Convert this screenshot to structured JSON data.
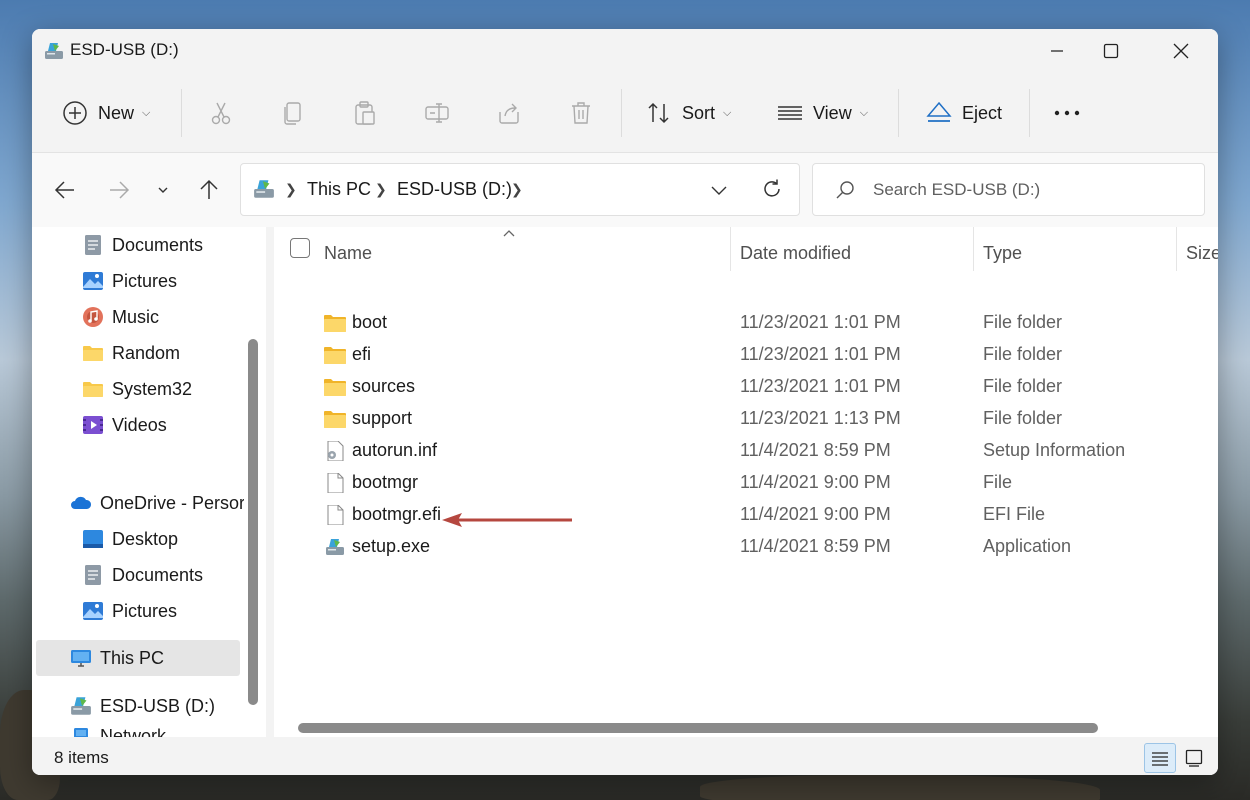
{
  "window": {
    "title": "ESD-USB (D:)",
    "controls": {
      "minimize": "minimize",
      "maximize": "maximize",
      "close": "close"
    }
  },
  "toolbar": {
    "new_label": "New",
    "sort_label": "Sort",
    "view_label": "View",
    "eject_label": "Eject"
  },
  "address": {
    "crumbs": [
      "This PC",
      "ESD-USB (D:)"
    ]
  },
  "search": {
    "placeholder": "Search ESD-USB (D:)"
  },
  "sidebar": {
    "items": [
      {
        "label": "Documents",
        "icon": "documents-icon",
        "pinned": true
      },
      {
        "label": "Pictures",
        "icon": "pictures-icon",
        "pinned": true
      },
      {
        "label": "Music",
        "icon": "music-icon"
      },
      {
        "label": "Random",
        "icon": "folder-icon"
      },
      {
        "label": "System32",
        "icon": "folder-icon"
      },
      {
        "label": "Videos",
        "icon": "videos-icon"
      },
      {
        "label": "OneDrive - Persor",
        "icon": "onedrive-icon"
      },
      {
        "label": "Desktop",
        "icon": "desktop-icon"
      },
      {
        "label": "Documents",
        "icon": "documents-icon"
      },
      {
        "label": "Pictures",
        "icon": "pictures-icon"
      },
      {
        "label": "This PC",
        "icon": "this-pc-icon",
        "selected": true
      },
      {
        "label": "ESD-USB (D:)",
        "icon": "usb-drive-icon"
      },
      {
        "label": "Network",
        "icon": "network-icon"
      }
    ]
  },
  "columns": {
    "name": "Name",
    "date": "Date modified",
    "type": "Type",
    "size": "Size"
  },
  "files": [
    {
      "name": "boot",
      "date": "11/23/2021 1:01 PM",
      "type": "File folder",
      "icon": "folder-icon"
    },
    {
      "name": "efi",
      "date": "11/23/2021 1:01 PM",
      "type": "File folder",
      "icon": "folder-icon"
    },
    {
      "name": "sources",
      "date": "11/23/2021 1:01 PM",
      "type": "File folder",
      "icon": "folder-icon"
    },
    {
      "name": "support",
      "date": "11/23/2021 1:13 PM",
      "type": "File folder",
      "icon": "folder-icon"
    },
    {
      "name": "autorun.inf",
      "date": "11/4/2021 8:59 PM",
      "type": "Setup Information",
      "icon": "setup-info-icon"
    },
    {
      "name": "bootmgr",
      "date": "11/4/2021 9:00 PM",
      "type": "File",
      "icon": "file-icon"
    },
    {
      "name": "bootmgr.efi",
      "date": "11/4/2021 9:00 PM",
      "type": "EFI File",
      "icon": "file-icon"
    },
    {
      "name": "setup.exe",
      "date": "11/4/2021 8:59 PM",
      "type": "Application",
      "icon": "setup-exe-icon"
    }
  ],
  "status": {
    "items_count": "8 items"
  },
  "colors": {
    "accent": "#0067c0",
    "folder": "#f8c94a",
    "arrow": "#b5473f",
    "selection": "#e5e5e5"
  }
}
